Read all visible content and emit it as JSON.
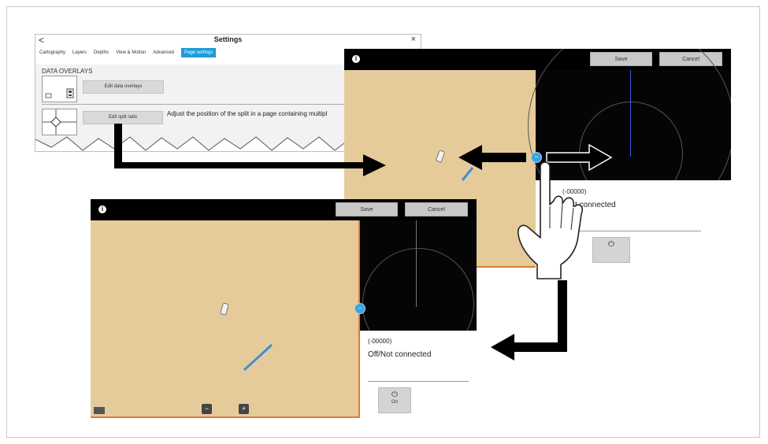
{
  "settings": {
    "back_glyph": "<",
    "title": "Settings",
    "close_glyph": "×",
    "tabs": [
      {
        "label": "Cartography"
      },
      {
        "label": "Layers"
      },
      {
        "label": "Depths"
      },
      {
        "label": "View & Motion"
      },
      {
        "label": "Advanced"
      },
      {
        "label": "Page settings"
      }
    ],
    "section_title": "DATA OVERLAYS",
    "edit_overlays_label": "Edit data overlays",
    "edit_split_label": "Edit split ratio",
    "split_description": "Adjust the position of the split in a page containing multipl"
  },
  "top_screen": {
    "info_glyph": "i",
    "save_label": "Save",
    "cancel_label": "Cancel",
    "code": "(-00000)",
    "status": "t connected"
  },
  "bottom_screen": {
    "info_glyph": "i",
    "save_label": "Save",
    "cancel_label": "Cancel",
    "code": "(-00000)",
    "status": "Off/Not connected",
    "power_label": "On",
    "zoom_out": "−",
    "zoom_in": "+"
  },
  "colors": {
    "chart_land": "#e6cb9a",
    "accent_blue": "#1e9bd7",
    "chart_border": "#e07a2f"
  },
  "icons": {
    "power": "power-icon",
    "handle": "split-handle-icon",
    "info": "info-icon"
  }
}
